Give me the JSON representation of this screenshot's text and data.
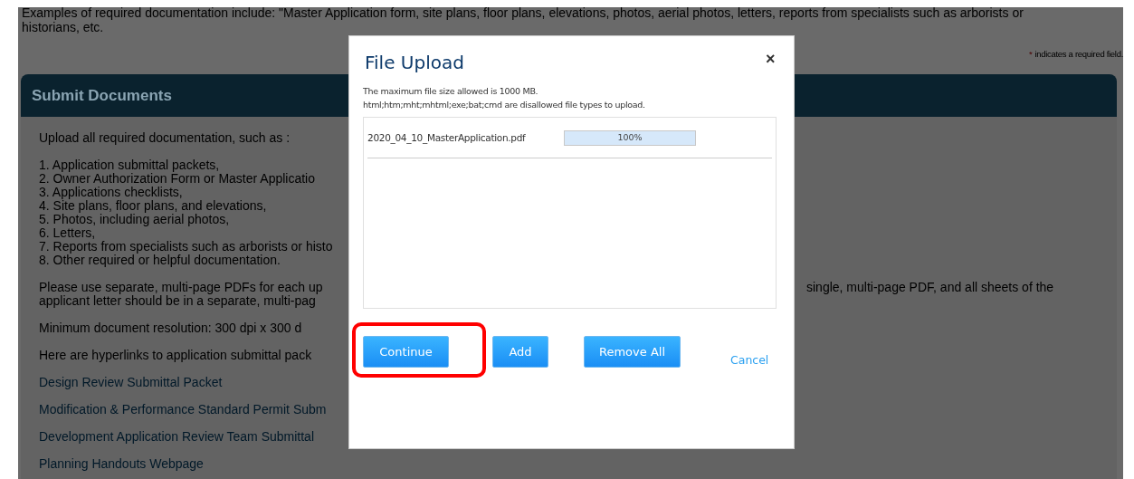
{
  "intro": {
    "lines": [
      "Examples of required documentation include: \"Master Application form, site plans, floor plans, elevations, photos, aerial photos, letters, reports from specialists such as arborists or",
      "historians, etc."
    ]
  },
  "required_note": {
    "mark": "*",
    "text": "indicates a required field."
  },
  "panel": {
    "title": "Submit Documents",
    "blocks": [
      {
        "kind": "text",
        "lines": [
          {
            "left": "Upload all required documentation, such as :"
          }
        ]
      },
      {
        "kind": "text",
        "lines": [
          {
            "left": "1. Application submittal packets,"
          },
          {
            "left": "2. Owner Authorization Form or Master Applicatio"
          },
          {
            "left": "3. Applications checklists,"
          },
          {
            "left": "4. Site plans, floor plans, and elevations,"
          },
          {
            "left": "5. Photos, including aerial photos,"
          },
          {
            "left": "6. Letters,"
          },
          {
            "left": "7. Reports from specialists such as arborists or histo"
          },
          {
            "left": "8. Other required or helpful documentation."
          }
        ]
      },
      {
        "kind": "text",
        "lines": [
          {
            "left": "Please use separate, multi-page PDFs for each up",
            "right": "single, multi-page PDF, and all sheets of the"
          },
          {
            "left": "applicant letter should be in a separate, multi-pag"
          }
        ]
      },
      {
        "kind": "text",
        "lines": [
          {
            "left": "Minimum document resolution:  300 dpi x 300 d"
          }
        ]
      },
      {
        "kind": "text",
        "lines": [
          {
            "left": "Here are hyperlinks to application submittal pack"
          }
        ]
      },
      {
        "kind": "link",
        "lines": [
          {
            "left": "Design Review Submittal Packet"
          }
        ]
      },
      {
        "kind": "link",
        "lines": [
          {
            "left": "Modification & Performance Standard Permit Subm"
          }
        ]
      },
      {
        "kind": "link",
        "lines": [
          {
            "left": "Development Application Review Team Submittal"
          }
        ]
      },
      {
        "kind": "link",
        "lines": [
          {
            "left": "Planning Handouts Webpage"
          }
        ]
      }
    ]
  },
  "dialog": {
    "title": "File Upload",
    "close": "×",
    "info": [
      "The maximum file size allowed is 1000 MB.",
      "html;htm;mht;mhtml;exe;bat;cmd are disallowed file types to upload."
    ],
    "files": [
      {
        "name": "2020_04_10_MasterApplication.pdf",
        "level": 1.0,
        "reading": "100%"
      }
    ],
    "buttons": [
      {
        "label": "Continue",
        "highlighted": true
      },
      {
        "label": "Add",
        "highlighted": false
      },
      {
        "label": "Remove All",
        "highlighted": false
      }
    ],
    "cancel": "Cancel"
  }
}
